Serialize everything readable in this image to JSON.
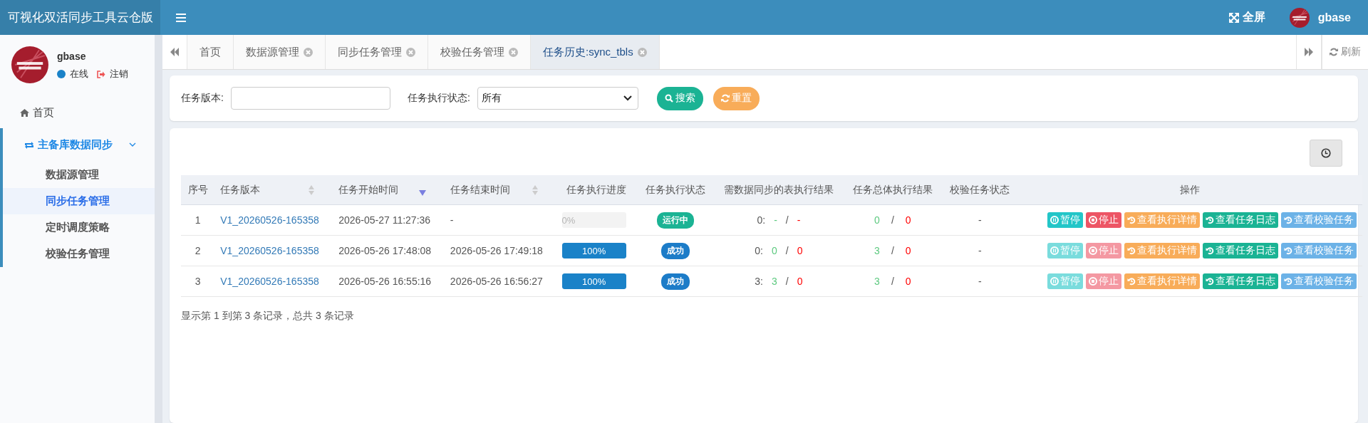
{
  "header": {
    "brand": "可视化双活同步工具云仓版",
    "fullscreen": "全屏",
    "user": "gbase"
  },
  "sidebar": {
    "user": {
      "name": "gbase",
      "status": "在线",
      "logout": "注销"
    },
    "items": [
      {
        "label": "首页",
        "kind": "link",
        "selected": false
      },
      {
        "label": "主备库数据同步",
        "kind": "group",
        "selected": false,
        "expanded": true,
        "children": [
          {
            "label": "数据源管理",
            "selected": false
          },
          {
            "label": "同步任务管理",
            "selected": true
          },
          {
            "label": "定时调度策略",
            "selected": false
          },
          {
            "label": "校验任务管理",
            "selected": false
          }
        ]
      }
    ]
  },
  "tabs": [
    {
      "label": "首页",
      "closable": false,
      "selected": false
    },
    {
      "label": "数据源管理",
      "closable": true,
      "selected": false
    },
    {
      "label": "同步任务管理",
      "closable": true,
      "selected": false
    },
    {
      "label": "校验任务管理",
      "closable": true,
      "selected": false
    },
    {
      "label": "任务历史:sync_tbls",
      "closable": true,
      "selected": true
    }
  ],
  "refresh": "刷新",
  "search": {
    "version_label": "任务版本:",
    "status_label": "任务执行状态:",
    "status_value": "所有",
    "search_button": "搜索",
    "reset_button": "重置"
  },
  "table": {
    "columns": [
      {
        "label": "序号",
        "sortable": false
      },
      {
        "label": "任务版本",
        "sortable": true,
        "sorted": false
      },
      {
        "label": "任务开始时间",
        "sortable": true,
        "sorted": true
      },
      {
        "label": "任务结束时间",
        "sortable": true,
        "sorted": false
      },
      {
        "label": "任务执行进度",
        "sortable": false
      },
      {
        "label": "任务执行状态",
        "sortable": false
      },
      {
        "label": "需数据同步的表执行结果",
        "sortable": false
      },
      {
        "label": "任务总体执行结果",
        "sortable": false
      },
      {
        "label": "校验任务状态",
        "sortable": false
      },
      {
        "label": "操作",
        "sortable": false
      }
    ],
    "rows": [
      {
        "index": "1",
        "version": "V1_20260526-165358",
        "start": "2026-05-27 11:27:36",
        "end": "-",
        "level": 0,
        "progress": "0%",
        "status": "运行中",
        "running": true,
        "tables": {
          "prefix": "0:",
          "ok": "-",
          "sep": "/",
          "fail": "-"
        },
        "total": {
          "ok": "0",
          "sep": "/",
          "fail": "0"
        },
        "check": "-",
        "actions": [
          {
            "label": "暂停",
            "kind": "pause",
            "disabled": false
          },
          {
            "label": "停止",
            "kind": "stop",
            "disabled": false
          },
          {
            "label": "查看执行详情",
            "kind": "detail",
            "disabled": false
          },
          {
            "label": "查看任务日志",
            "kind": "log",
            "disabled": false
          },
          {
            "label": "查看校验任务",
            "kind": "check",
            "disabled": false
          }
        ]
      },
      {
        "index": "2",
        "version": "V1_20260526-165358",
        "start": "2026-05-26 17:48:08",
        "end": "2026-05-26 17:49:18",
        "level": 1,
        "progress": "100%",
        "status": "成功",
        "running": false,
        "tables": {
          "prefix": "0:",
          "ok": "0",
          "sep": "/",
          "fail": "0"
        },
        "total": {
          "ok": "3",
          "sep": "/",
          "fail": "0"
        },
        "check": "-",
        "actions": [
          {
            "label": "暂停",
            "kind": "pause",
            "disabled": true
          },
          {
            "label": "停止",
            "kind": "stop",
            "disabled": true
          },
          {
            "label": "查看执行详情",
            "kind": "detail",
            "disabled": false
          },
          {
            "label": "查看任务日志",
            "kind": "log",
            "disabled": false
          },
          {
            "label": "查看校验任务",
            "kind": "check",
            "disabled": false
          }
        ]
      },
      {
        "index": "3",
        "version": "V1_20260526-165358",
        "start": "2026-05-26 16:55:16",
        "end": "2026-05-26 16:56:27",
        "level": 1,
        "progress": "100%",
        "status": "成功",
        "running": false,
        "tables": {
          "prefix": "3:",
          "ok": "3",
          "sep": "/",
          "fail": "0"
        },
        "total": {
          "ok": "3",
          "sep": "/",
          "fail": "0"
        },
        "check": "-",
        "actions": [
          {
            "label": "暂停",
            "kind": "pause",
            "disabled": true
          },
          {
            "label": "停止",
            "kind": "stop",
            "disabled": true
          },
          {
            "label": "查看执行详情",
            "kind": "detail",
            "disabled": false
          },
          {
            "label": "查看任务日志",
            "kind": "log",
            "disabled": false
          },
          {
            "label": "查看校验任务",
            "kind": "check",
            "disabled": false
          }
        ]
      }
    ],
    "footer": "显示第 1 到第 3 条记录，总共 3 条记录"
  }
}
